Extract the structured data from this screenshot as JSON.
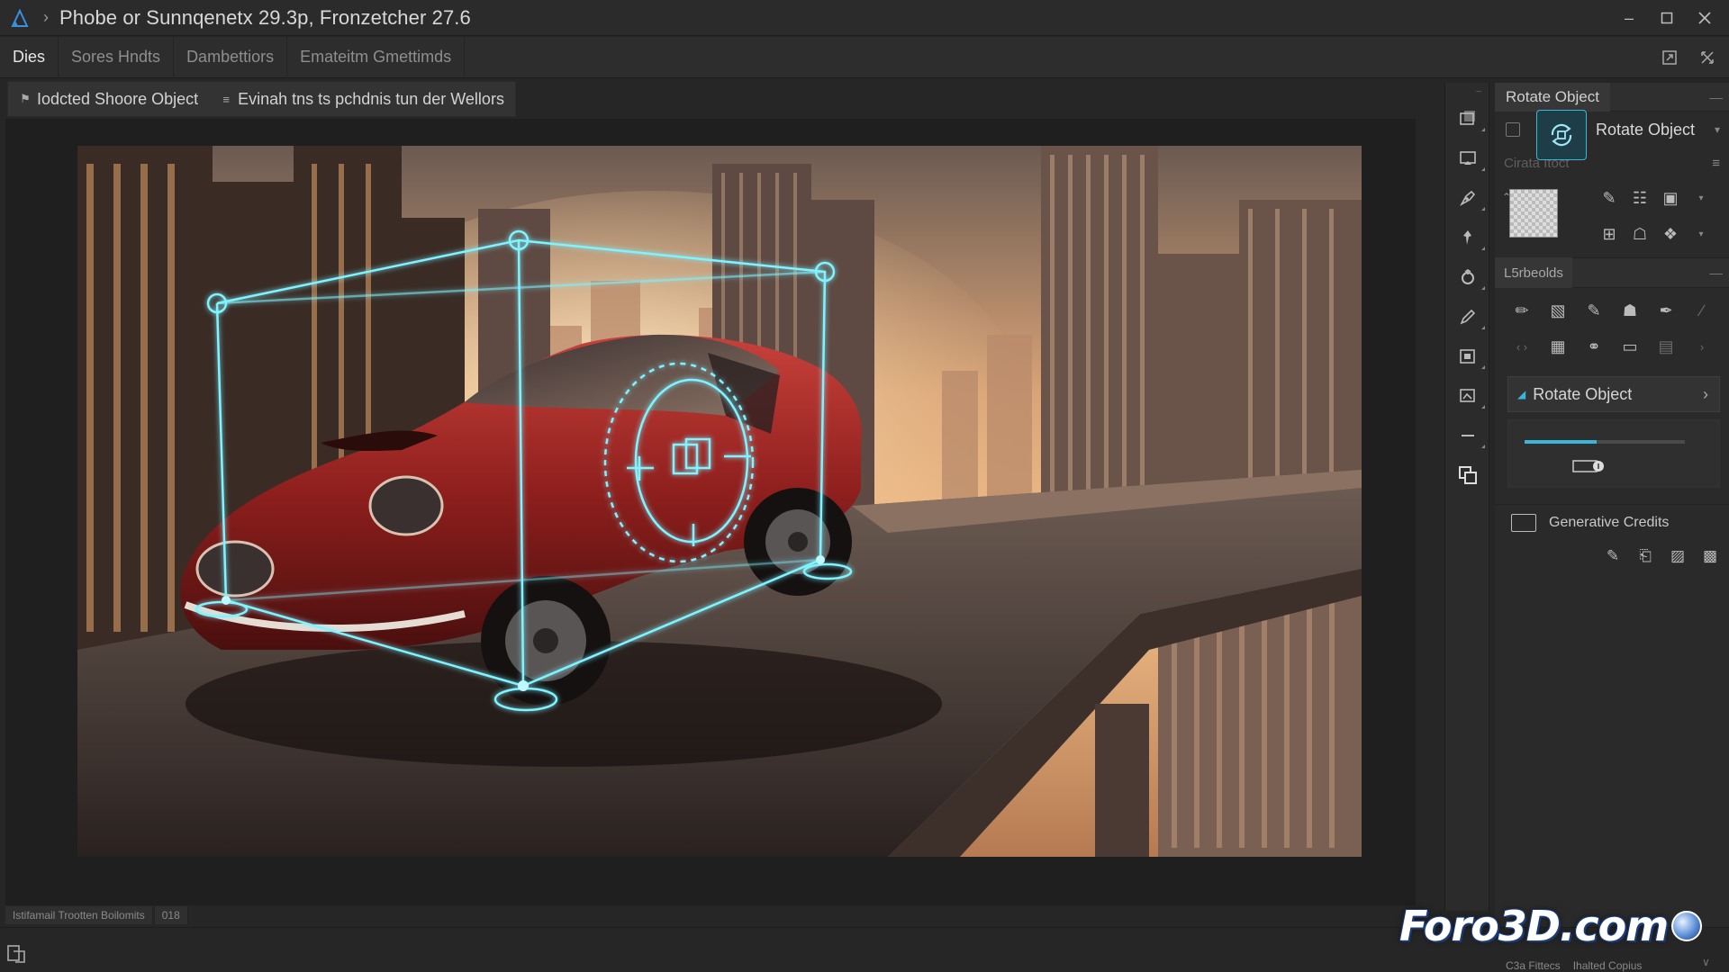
{
  "titlebar": {
    "title": "Phobe or Sunnqenetx 29.3p, Fronzetcher 27.6"
  },
  "menubar": {
    "items": [
      "Dies",
      "Sores Hndts",
      "Dambettiors",
      "Emateitm Gmettimds"
    ],
    "active_index": 0
  },
  "options": {
    "item1": "Iodcted Shoore Object",
    "item2": "Evinah tns ts pchdnis tun der Wellors"
  },
  "status": {
    "seg1": "Istifamail Trootten Boilomits",
    "seg2": "018"
  },
  "right_panel": {
    "tab_label": "Rotate Object",
    "rotate_dropdown_label": "Rotate Object",
    "ghost_label": "Cirata Itoct",
    "section2_label": "L5rbeolds",
    "rotate_button_label": "Rotate Object",
    "slider_fraction": 0.45,
    "credits_label": "Generative Credits"
  },
  "footer": {
    "left": "C3a Fittecs",
    "right": "Ihalted Copius"
  },
  "watermark": {
    "text": "Foro3D.com"
  },
  "colors": {
    "accent": "#3ab6d9",
    "gizmo": "#7ff3ff",
    "car_red": "#8e1f1d"
  },
  "icons": {
    "app": "app-logo-icon",
    "tools": [
      "artboard-icon",
      "crop-icon",
      "pen-tool-icon",
      "pin-icon",
      "rotate-icon",
      "pencil-icon",
      "frame-icon",
      "image-icon",
      "minus-icon",
      "copy-shape-icon"
    ]
  }
}
